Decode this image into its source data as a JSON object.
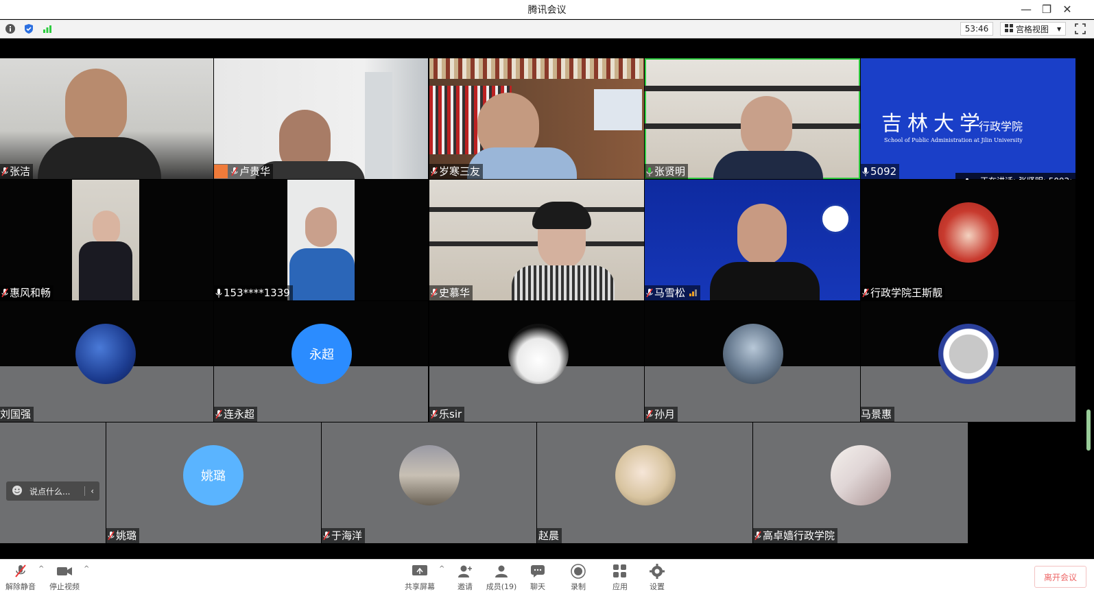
{
  "window": {
    "title": "腾讯会议"
  },
  "toolbar": {
    "timer": "53:46",
    "view_label": "宫格视图"
  },
  "speaking": "正在讲话: 张贤明; 5092;",
  "participants": [
    {
      "name": "张洁"
    },
    {
      "name": "卢贵华"
    },
    {
      "name": "岁寒三友"
    },
    {
      "name": "张贤明"
    },
    {
      "name": "5092"
    },
    {
      "name": "惠风和畅"
    },
    {
      "name": "153****1339"
    },
    {
      "name": "史慕华"
    },
    {
      "name": "马雪松"
    },
    {
      "name": "行政学院王斯靓"
    },
    {
      "name": "刘国强"
    },
    {
      "name": "连永超",
      "avatar_text": "永超"
    },
    {
      "name": "乐sir"
    },
    {
      "name": "孙月"
    },
    {
      "name": "马景惠"
    },
    {
      "name": "姚璐",
      "avatar_text": "姚璐"
    },
    {
      "name": "于海洋"
    },
    {
      "name": "赵晨"
    },
    {
      "name": "高卓嫱行政学院"
    }
  ],
  "jilin_logo": {
    "cn": "吉林大学",
    "dept": "行政学院",
    "en": "School of Public Administration at Jilin University"
  },
  "chat": {
    "placeholder": "说点什么..."
  },
  "bottom": {
    "unmute": "解除静音",
    "stop_video": "停止视频",
    "share": "共享屏幕",
    "invite": "邀请",
    "members": "成员(19)",
    "chat": "聊天",
    "record": "录制",
    "apps": "应用",
    "settings": "设置",
    "leave": "离开会议"
  },
  "colors": {
    "accent_blue": "#2b8cff",
    "avatar_blue_light": "#5ab4ff",
    "active_speaker_border": "#2ecc40",
    "leave_red": "#e66666"
  }
}
